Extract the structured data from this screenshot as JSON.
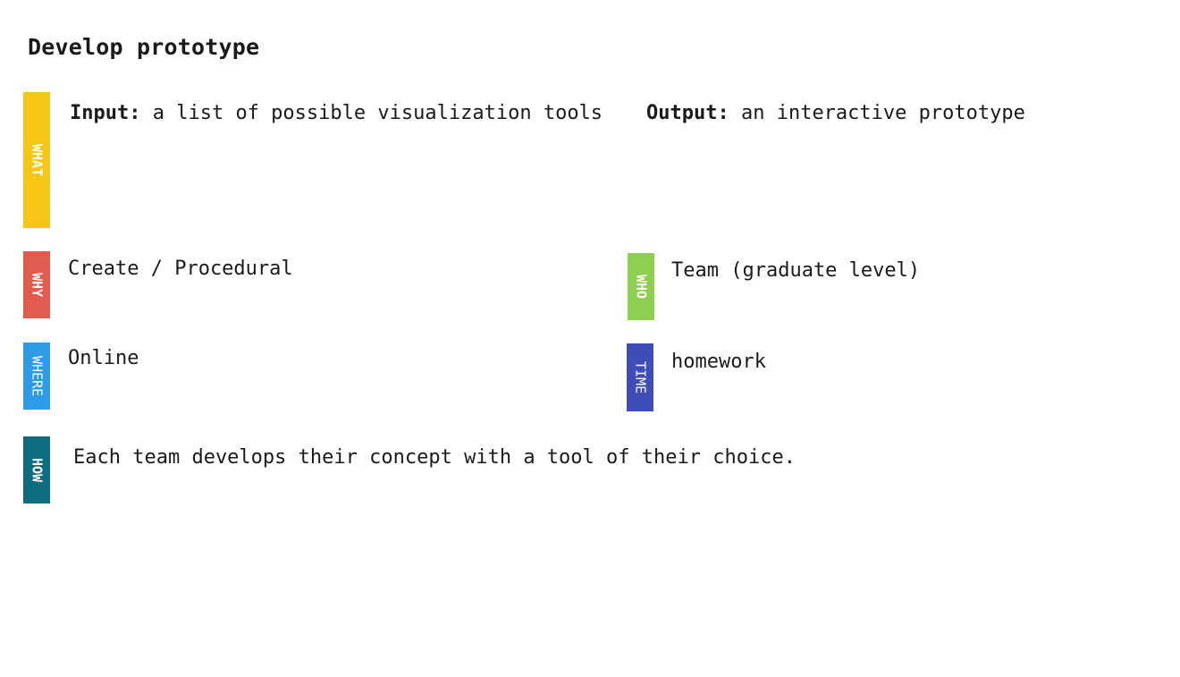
{
  "title": "Develop prototype",
  "tags": {
    "what": {
      "label": "WHAT",
      "color": "#F5C518",
      "text_color": "#ffffff"
    },
    "why": {
      "label": "WHY",
      "color": "#E05A4E",
      "text_color": "#ffffff"
    },
    "who": {
      "label": "WHO",
      "color": "#8DCF4E",
      "text_color": "#ffffff"
    },
    "where": {
      "label": "WHERE",
      "color": "#2E9BE6",
      "text_color": "#ffffff"
    },
    "time": {
      "label": "TIME",
      "color": "#3F4DB8",
      "text_color": "#ffffff"
    },
    "how": {
      "label": "HOW",
      "color": "#0E6B80",
      "text_color": "#ffffff"
    }
  },
  "what": {
    "input_label": "Input:",
    "input_text": "a list of possible visualization tools",
    "output_label": "Output:",
    "output_text": "an interactive prototype"
  },
  "why": {
    "text": "Create / Procedural"
  },
  "who": {
    "text": "Team (graduate level)"
  },
  "where": {
    "text": "Online"
  },
  "time": {
    "text": "homework"
  },
  "how": {
    "text": "Each team develops their concept with a tool of their choice."
  }
}
